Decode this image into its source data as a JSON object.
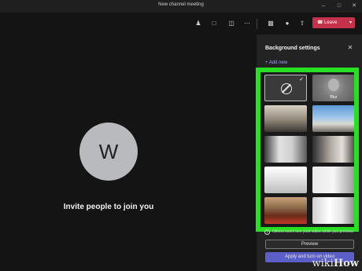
{
  "window": {
    "title": "New channel meeting",
    "controls": [
      "minimize-icon",
      "maximize-icon",
      "close-icon"
    ]
  },
  "toolbar": {
    "icons": [
      "participants-icon",
      "chat-icon",
      "share-tray-icon",
      "more-actions-icon",
      "camera-off-icon",
      "mic-icon",
      "share-screen-icon"
    ],
    "leave_label": "Leave",
    "leave_color": "#c4314b"
  },
  "stage": {
    "avatar_initial": "W",
    "invite_text": "Invite people to join you"
  },
  "background_panel": {
    "title": "Background settings",
    "add_new_label": "+ Add new",
    "tiles": [
      {
        "kind": "none",
        "selected": true
      },
      {
        "kind": "blur",
        "label": "Blur"
      },
      {
        "kind": "image"
      },
      {
        "kind": "image"
      },
      {
        "kind": "image"
      },
      {
        "kind": "image"
      },
      {
        "kind": "image"
      },
      {
        "kind": "image"
      },
      {
        "kind": "image"
      },
      {
        "kind": "image"
      },
      {
        "kind": "image"
      },
      {
        "kind": "image"
      }
    ],
    "highlight_color": "#28e021",
    "note": "Others won't see your video while you preview.",
    "preview_label": "Preview",
    "apply_label": "Apply and turn on video"
  },
  "watermark": {
    "wiki": "wiki",
    "how": "How"
  }
}
